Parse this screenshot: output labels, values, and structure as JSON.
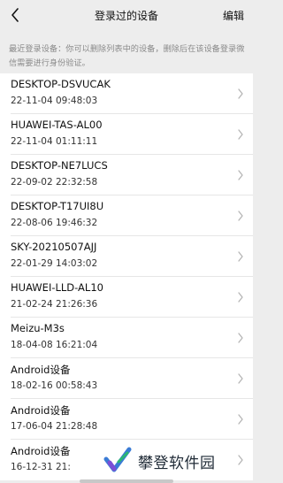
{
  "nav": {
    "title": "登录过的设备",
    "edit_label": "编辑",
    "back_icon": "chevron-left-icon"
  },
  "notice": "最近登录设备：你可以删除列表中的设备，删除后在该设备登录微信需要进行身份验证。",
  "devices": [
    {
      "name": "DESKTOP-DSVUCAK",
      "time": "22-11-04 09:48:03"
    },
    {
      "name": "HUAWEI-TAS-AL00",
      "time": "22-11-04 01:11:11"
    },
    {
      "name": "DESKTOP-NE7LUCS",
      "time": "22-09-02 22:32:58"
    },
    {
      "name": "DESKTOP-T17UI8U",
      "time": "22-08-06 19:46:32"
    },
    {
      "name": "SKY-20210507AJJ",
      "time": "22-01-29 14:03:02"
    },
    {
      "name": "HUAWEI-LLD-AL10",
      "time": "21-02-24 21:26:36"
    },
    {
      "name": "Meizu-M3s",
      "time": "18-04-08 16:21:04"
    },
    {
      "name": "Android设备",
      "time": "18-02-16 00:58:43"
    },
    {
      "name": "Android设备",
      "time": "17-06-04 21:28:48"
    },
    {
      "name": "Android设备",
      "time": "16-12-31 21:"
    }
  ],
  "watermark": {
    "text": "攀登软件园",
    "colors": {
      "blue": "#3a7bd5",
      "purple": "#7b4fd6",
      "green": "#2bb673"
    }
  },
  "colors": {
    "background": "#ededed",
    "list_background": "#ffffff",
    "divider": "#e6e6e6",
    "notice_text": "#8a8a8a",
    "chevron": "#b5b5b5"
  }
}
